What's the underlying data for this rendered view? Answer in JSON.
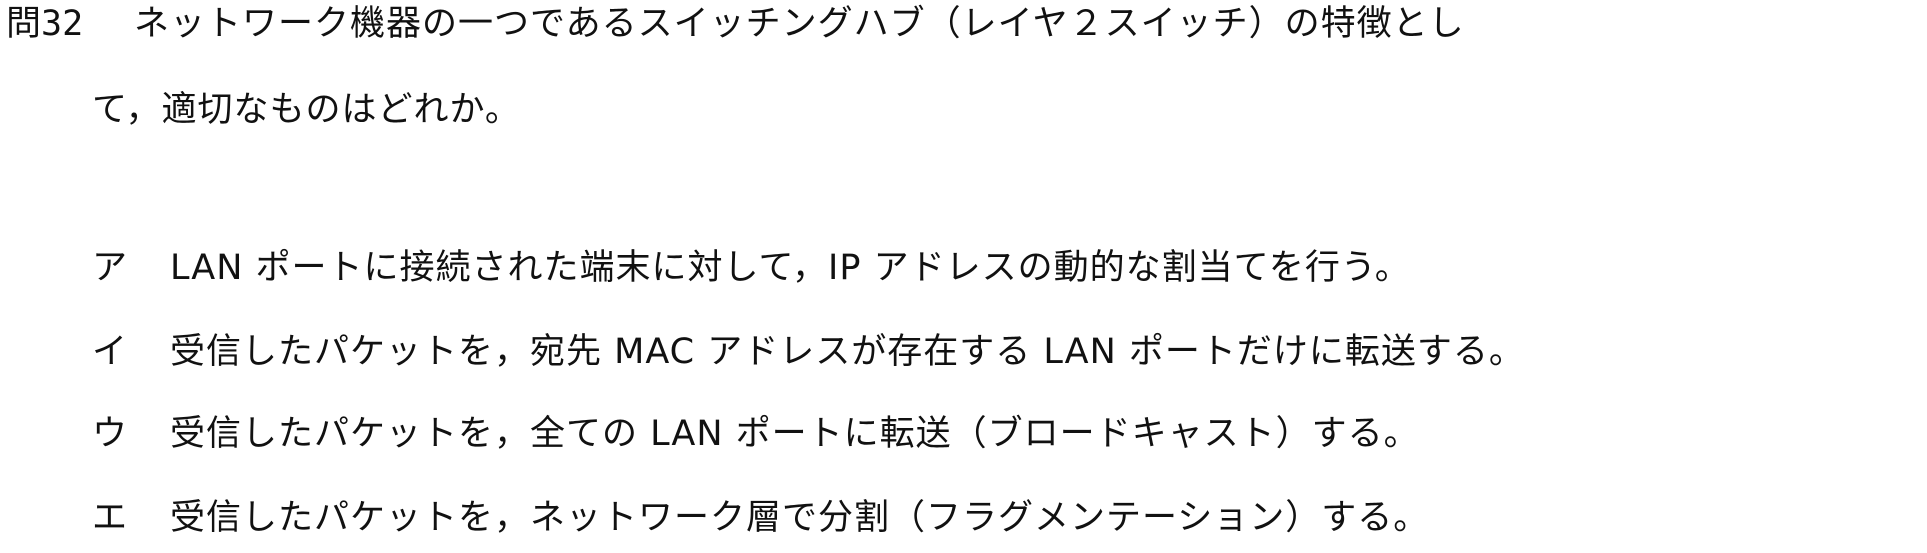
{
  "question": {
    "number": "問32",
    "stem_line1": "ネットワーク機器の一つであるスイッチングハブ（レイヤ２スイッチ）の特徴とし",
    "stem_line2": "て，適切なものはどれか。"
  },
  "choices": [
    {
      "letter": "ア",
      "text": "LAN ポートに接続された端末に対して，IP アドレスの動的な割当てを行う。"
    },
    {
      "letter": "イ",
      "text": "受信したパケットを，宛先 MAC アドレスが存在する LAN ポートだけに転送する。"
    },
    {
      "letter": "ウ",
      "text": "受信したパケットを，全ての LAN ポートに転送（ブロードキャスト）する。"
    },
    {
      "letter": "エ",
      "text": "受信したパケットを，ネットワーク層で分割（フラグメンテーション）する。"
    }
  ]
}
